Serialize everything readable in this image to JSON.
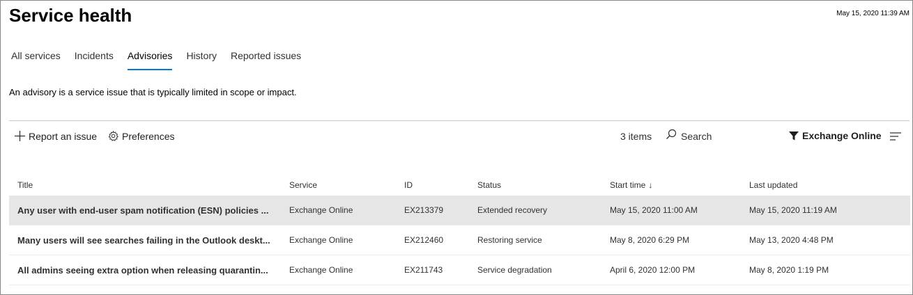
{
  "header": {
    "title": "Service health",
    "timestamp": "May 15, 2020 11:39 AM"
  },
  "tabs": [
    {
      "label": "All services"
    },
    {
      "label": "Incidents"
    },
    {
      "label": "Advisories",
      "active": true
    },
    {
      "label": "History"
    },
    {
      "label": "Reported issues"
    }
  ],
  "description": "An advisory is a service issue that is typically limited in scope or impact.",
  "commandbar": {
    "report_label": "Report an issue",
    "preferences_label": "Preferences",
    "items_count": "3 items",
    "search_placeholder": "Search",
    "filter_label": "Exchange Online",
    "icons": {
      "report": "plus-icon",
      "preferences": "gear-icon",
      "search": "search-icon",
      "filter": "filter-icon",
      "menu": "lines-menu-icon"
    }
  },
  "table": {
    "columns": {
      "title": "Title",
      "service": "Service",
      "id": "ID",
      "status": "Status",
      "start_time": "Start time",
      "last_updated": "Last updated"
    },
    "sort_indicator": "↓",
    "rows": [
      {
        "title": "Any user with end-user spam notification (ESN) policies ...",
        "service": "Exchange Online",
        "id": "EX213379",
        "status": "Extended recovery",
        "start_time": "May 15, 2020 11:00 AM",
        "last_updated": "May 15, 2020 11:19 AM",
        "selected": true
      },
      {
        "title": "Many users will see searches failing in the Outlook deskt...",
        "service": "Exchange Online",
        "id": "EX212460",
        "status": "Restoring service",
        "start_time": "May 8, 2020 6:29 PM",
        "last_updated": "May 13, 2020 4:48 PM"
      },
      {
        "title": "All admins seeing extra option when releasing quarantin...",
        "service": "Exchange Online",
        "id": "EX211743",
        "status": "Service degradation",
        "start_time": "April 6, 2020 12:00 PM",
        "last_updated": "May 8, 2020 1:19 PM"
      }
    ]
  },
  "colors": {
    "accent": "#0078d4",
    "selected_row": "#e6e6e6",
    "divider": "#c8c6c4"
  }
}
